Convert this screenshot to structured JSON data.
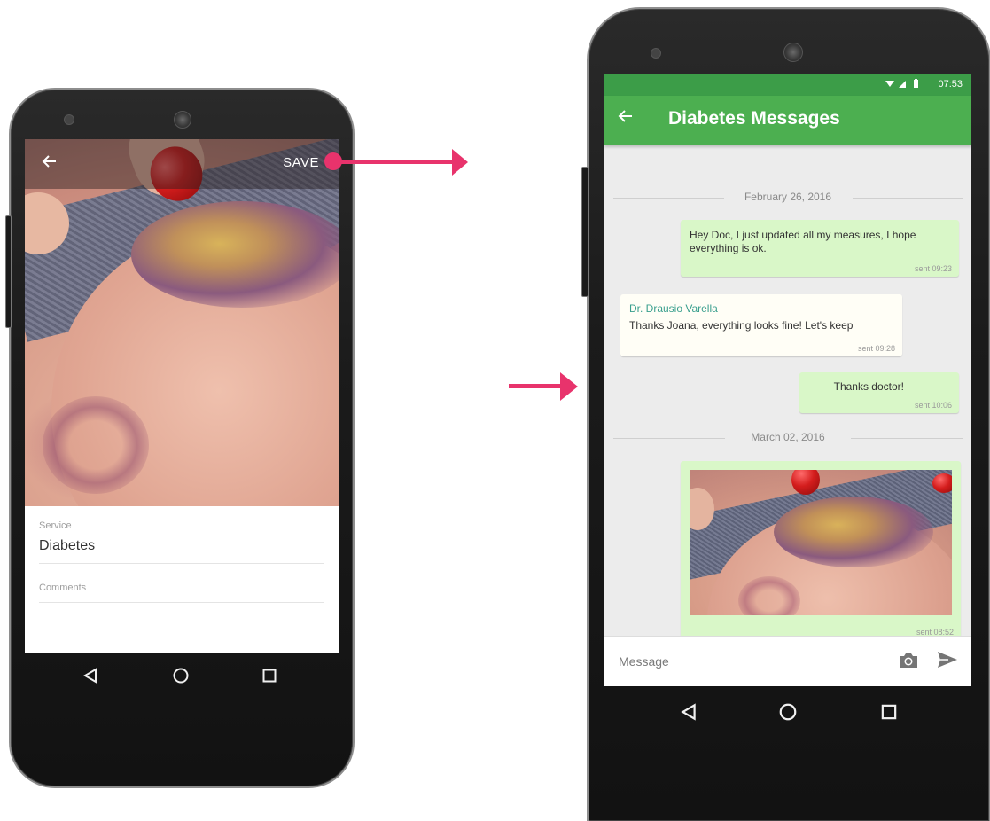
{
  "phone1": {
    "toolbar": {
      "back_icon": "arrow-back-icon",
      "save_label": "SAVE"
    },
    "form": {
      "service_label": "Service",
      "service_value": "Diabetes",
      "comments_label": "Comments",
      "comments_value": ""
    },
    "nav": [
      "back-triangle-icon",
      "home-circle-icon",
      "recents-square-icon"
    ]
  },
  "phone2": {
    "status_bar": {
      "time": "07:53",
      "icons": [
        "wifi-icon",
        "signal-icon",
        "battery-icon"
      ]
    },
    "app_bar": {
      "back_icon": "arrow-back-icon",
      "title": "Diabetes Messages"
    },
    "messages": {
      "date1": "February 26, 2016",
      "msg1": {
        "text": "Hey Doc, I just updated all my measures, I hope everything is ok.",
        "meta": "sent 09:23"
      },
      "msg2": {
        "sender": "Dr. Drausio Varella",
        "text": "Thanks Joana, everything looks fine! Let's keep",
        "meta": "sent 09:28"
      },
      "msg3": {
        "text": "Thanks doctor!",
        "meta": "sent 10:06"
      },
      "date2": "March 02, 2016",
      "msg4": {
        "meta": "sent 08:52"
      }
    },
    "composer": {
      "placeholder": "Message",
      "camera_icon": "camera-icon",
      "send_icon": "send-icon"
    },
    "nav": [
      "back-triangle-icon",
      "home-circle-icon",
      "recents-square-icon"
    ]
  },
  "colors": {
    "accent_arrow": "#e8336c",
    "app_bar_green": "#4caf50",
    "status_bar_green": "#3c9d48",
    "outgoing_bubble": "#d9f7c8",
    "incoming_bubble": "#fffef6",
    "sender_name": "#3a9f8e"
  }
}
